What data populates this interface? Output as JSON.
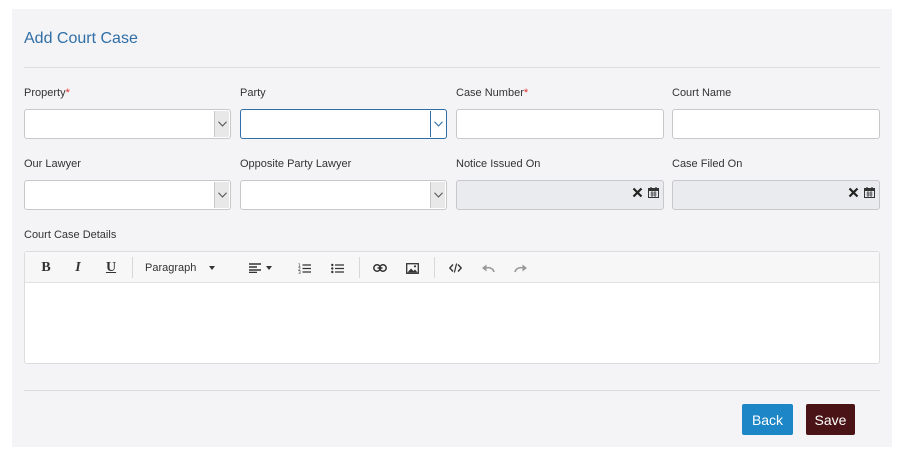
{
  "form": {
    "title": "Add Court Case",
    "fields": {
      "property": {
        "label": "Property",
        "required_mark": "*"
      },
      "party": {
        "label": "Party"
      },
      "case_number": {
        "label": "Case Number",
        "required_mark": "*"
      },
      "court_name": {
        "label": "Court Name"
      },
      "our_lawyer": {
        "label": "Our Lawyer"
      },
      "opposite_party_lawyer": {
        "label": "Opposite Party Lawyer"
      },
      "notice_issued_on": {
        "label": "Notice Issued On"
      },
      "case_filed_on": {
        "label": "Case Filed On"
      },
      "court_case_details": {
        "label": "Court Case Details"
      }
    },
    "editor": {
      "format_label": "Paragraph",
      "tools": [
        "bold-icon",
        "italic-icon",
        "underline-icon",
        "paragraph-format-dropdown",
        "align-icon",
        "ordered-list-icon",
        "unordered-list-icon",
        "link-icon",
        "image-icon",
        "code-view-icon",
        "undo-icon",
        "redo-icon"
      ]
    },
    "actions": {
      "back_label": "Back",
      "save_label": "Save"
    }
  },
  "colors": {
    "accent": "#2f6ea6",
    "back_button": "#1d86c7",
    "save_button": "#4a1416",
    "required": "#e03030"
  }
}
